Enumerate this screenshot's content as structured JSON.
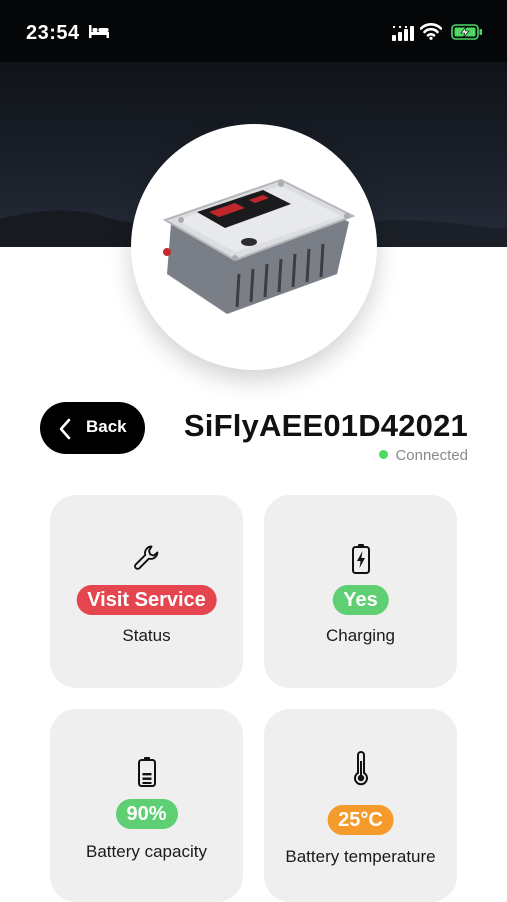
{
  "status_bar": {
    "time": "23:54",
    "icons": [
      "bed-icon",
      "signal-icon",
      "wifi-icon",
      "battery-charging-icon"
    ]
  },
  "header": {
    "back_label": "Back",
    "device_name": "SiFlyAEE01D42021",
    "connection_status": "Connected",
    "connection_color": "#4cd964"
  },
  "cards": [
    {
      "icon": "wrench-icon",
      "value": "Visit Service",
      "label": "Status",
      "color": "#e5454f"
    },
    {
      "icon": "battery-charging-icon",
      "value": "Yes",
      "label": "Charging",
      "color": "#5fcf74"
    },
    {
      "icon": "battery-icon",
      "value": "90%",
      "label": "Battery capacity",
      "color": "#5fcf74"
    },
    {
      "icon": "thermometer-icon",
      "value": "25°C",
      "label": "Battery temperature",
      "color": "#f49b2c"
    }
  ]
}
